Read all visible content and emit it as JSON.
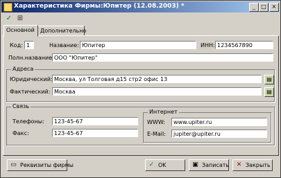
{
  "window": {
    "title": "Характеристика Фирмы:Юпитер (12.08.2003) *"
  },
  "titlebar_buttons": [
    {
      "icon": "minimize-icon",
      "glyph": "_"
    },
    {
      "icon": "maximize-icon",
      "glyph": "□"
    },
    {
      "icon": "close-icon",
      "glyph": "×"
    }
  ],
  "toolbar": [
    {
      "icon": "checkmark-icon",
      "glyph": "✓"
    },
    {
      "icon": "tree-icon",
      "glyph": "⊞"
    }
  ],
  "tabs": [
    {
      "label": "Основной",
      "active": true
    },
    {
      "label": "Дополнительно",
      "active": false
    }
  ],
  "form": {
    "code_label": "Код:",
    "code_value": "1",
    "name_label": "Название:",
    "name_value": "Юпитер",
    "inn_label": "ИНН:",
    "inn_value": "1234567890",
    "fullname_label": "Полн.название:",
    "fullname_value": "ООО \"Юпитер\""
  },
  "address": {
    "title": "Адреса",
    "legal_label": "Юридический:",
    "legal_value": "Москва, ул Толговая д15 стр2 офис 13",
    "actual_label": "Фактический:",
    "actual_value": "Москва"
  },
  "contacts": {
    "title": "Связь",
    "phone_label": "Телефоны:",
    "phone_value": "123-45-67",
    "fax_label": "Факс:",
    "fax_value": "123-45-67"
  },
  "internet": {
    "title": "Интернет",
    "www_label": "WWW:",
    "www_value": "www.upiter.ru",
    "email_label": "E-Mail:",
    "email_value": "jupiter@upiter.ru"
  },
  "buttons": {
    "print_label": "Реквизиты фирмы",
    "ok_label": "OK",
    "save_label": "Записать",
    "close_label": "Закрыть"
  },
  "colors": {
    "title_start": "#0a246a",
    "title_end": "#a6caf0",
    "face": "#d4d0c8"
  }
}
